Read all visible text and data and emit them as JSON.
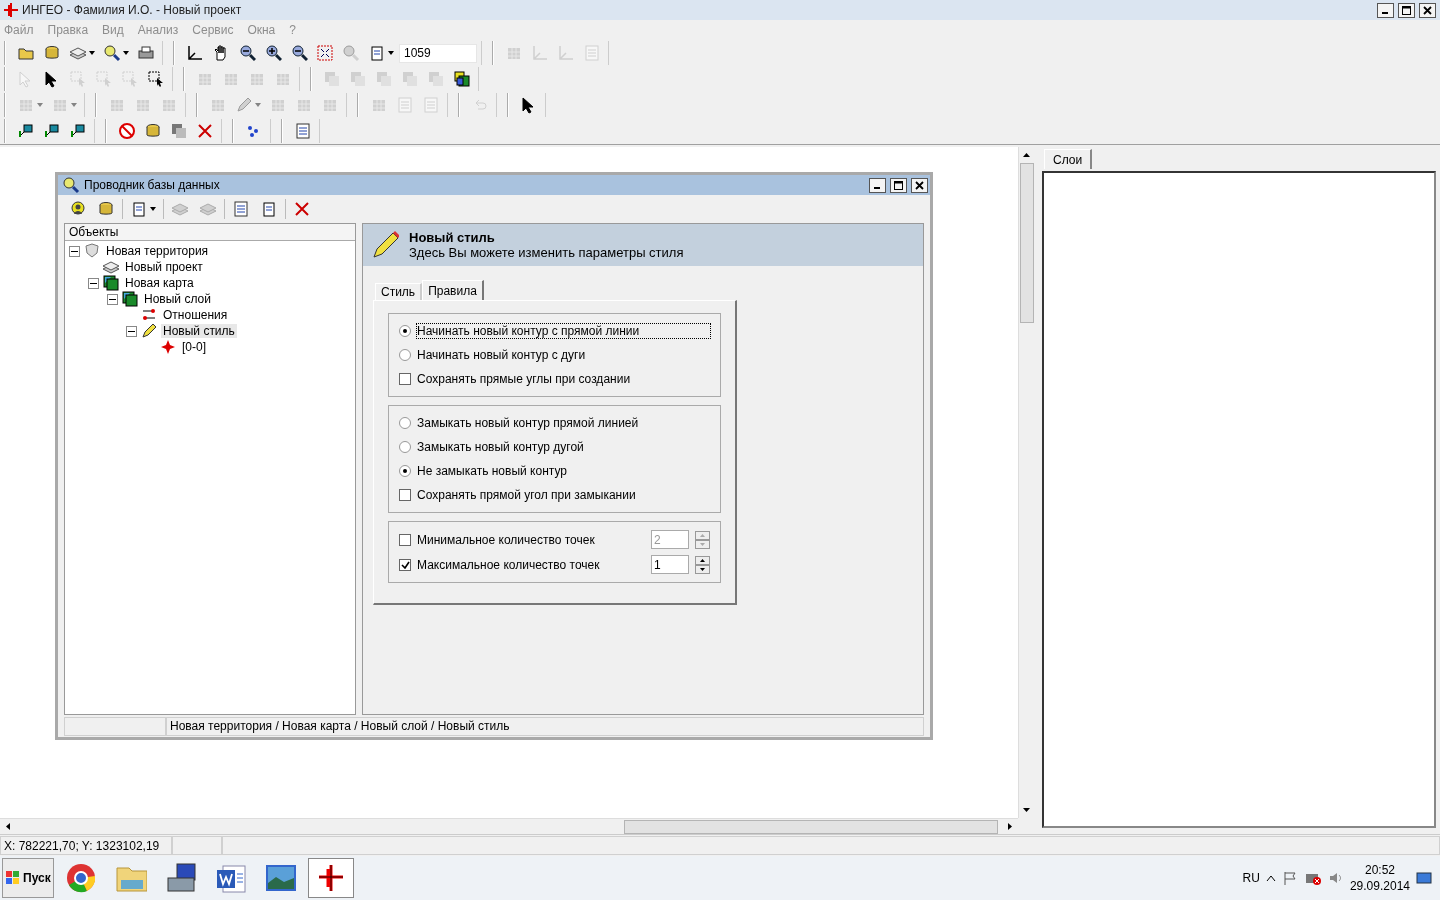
{
  "window": {
    "title": "ИНГЕО - Фамилия И.О. - Новый проект"
  },
  "menu": [
    {
      "label": "Файл",
      "disabled": true
    },
    {
      "label": "Правка",
      "disabled": true
    },
    {
      "label": "Вид",
      "disabled": true
    },
    {
      "label": "Анализ",
      "disabled": true
    },
    {
      "label": "Сервис",
      "disabled": true
    },
    {
      "label": "Окна",
      "disabled": true
    },
    {
      "label": "?",
      "disabled": true
    }
  ],
  "toolbars": [
    [
      [
        {
          "kind": "folder",
          "disabled": false
        },
        {
          "kind": "database",
          "disabled": false
        },
        {
          "kind": "layers",
          "disabled": false,
          "dropdown": true
        },
        {
          "kind": "magnifier",
          "disabled": false,
          "dropdown": true
        },
        {
          "kind": "printer",
          "disabled": false
        }
      ],
      [
        {
          "kind": "axes",
          "disabled": false
        },
        {
          "kind": "hand",
          "disabled": false
        },
        {
          "kind": "zoom-area",
          "disabled": false
        },
        {
          "kind": "zoom-in",
          "disabled": false
        },
        {
          "kind": "zoom-out",
          "disabled": false
        },
        {
          "kind": "extent",
          "disabled": false
        },
        {
          "kind": "magnifier",
          "disabled": true
        },
        {
          "kind": "document",
          "disabled": false,
          "dropdown": true
        },
        {
          "kind": "field",
          "value": "1059"
        }
      ],
      [
        {
          "kind": "grid",
          "disabled": true
        },
        {
          "kind": "axes",
          "disabled": true
        },
        {
          "kind": "axes",
          "disabled": true
        },
        {
          "kind": "table",
          "disabled": true
        }
      ]
    ],
    [
      [
        {
          "kind": "pointer",
          "disabled": true
        },
        {
          "kind": "pointer",
          "disabled": false
        },
        {
          "kind": "selection",
          "disabled": true
        },
        {
          "kind": "selection",
          "disabled": true
        },
        {
          "kind": "selection",
          "disabled": true
        },
        {
          "kind": "selection",
          "disabled": false
        }
      ],
      [
        {
          "kind": "grid",
          "disabled": true
        },
        {
          "kind": "grid",
          "disabled": true
        },
        {
          "kind": "grid",
          "disabled": true
        },
        {
          "kind": "grid",
          "disabled": true
        }
      ],
      [
        {
          "kind": "square",
          "disabled": true
        },
        {
          "kind": "square",
          "disabled": true
        },
        {
          "kind": "square",
          "disabled": true
        },
        {
          "kind": "square",
          "disabled": true
        },
        {
          "kind": "square",
          "disabled": true
        },
        {
          "kind": "stack",
          "disabled": false
        }
      ]
    ],
    [
      [
        {
          "kind": "grid",
          "disabled": true,
          "dropdown": true
        },
        {
          "kind": "grid",
          "disabled": true,
          "dropdown": true
        }
      ],
      [
        {
          "kind": "grid",
          "disabled": true
        },
        {
          "kind": "grid",
          "disabled": true
        },
        {
          "kind": "grid",
          "disabled": true
        }
      ],
      [
        {
          "kind": "grid",
          "disabled": true
        },
        {
          "kind": "pencil",
          "disabled": true,
          "dropdown": true
        },
        {
          "kind": "grid",
          "disabled": true
        },
        {
          "kind": "grid",
          "disabled": true
        },
        {
          "kind": "grid",
          "disabled": true
        }
      ],
      [
        {
          "kind": "grid",
          "disabled": true
        },
        {
          "kind": "table",
          "disabled": true
        },
        {
          "kind": "table",
          "disabled": true
        }
      ],
      [
        {
          "kind": "undo",
          "disabled": true
        }
      ],
      [
        {
          "kind": "pointer",
          "disabled": false
        }
      ]
    ],
    [
      [
        {
          "kind": "pin",
          "disabled": false
        },
        {
          "kind": "pin",
          "disabled": false
        },
        {
          "kind": "pin",
          "disabled": false
        }
      ],
      [
        {
          "kind": "no-sign",
          "disabled": false
        },
        {
          "kind": "database",
          "disabled": false
        },
        {
          "kind": "square",
          "disabled": false
        },
        {
          "kind": "cross",
          "disabled": false
        }
      ],
      [
        {
          "kind": "dots",
          "disabled": false
        }
      ],
      [
        {
          "kind": "table",
          "disabled": false
        }
      ]
    ]
  ],
  "dialog": {
    "title": "Проводник базы данных",
    "toolbar": [
      [
        {
          "kind": "person",
          "disabled": false
        },
        {
          "kind": "database",
          "disabled": false
        }
      ],
      [
        {
          "kind": "document",
          "disabled": false,
          "dropdown": true
        }
      ],
      [
        {
          "kind": "layers",
          "disabled": true
        },
        {
          "kind": "layers",
          "disabled": true
        }
      ],
      [
        {
          "kind": "table",
          "disabled": false
        },
        {
          "kind": "document",
          "disabled": false
        }
      ],
      [
        {
          "kind": "cross",
          "disabled": false
        }
      ]
    ],
    "tree": {
      "header": "Объекты",
      "items": [
        {
          "label": "Новая территория",
          "kind": "shield",
          "selected": false,
          "expanded": true,
          "children": [
            {
              "label": "Новый проект",
              "kind": "layers",
              "selected": false
            },
            {
              "label": "Новая карта",
              "kind": "map",
              "selected": false,
              "expanded": true,
              "children": [
                {
                  "label": "Новый слой",
                  "kind": "map",
                  "selected": false,
                  "expanded": true,
                  "children": [
                    {
                      "label": "Отношения",
                      "kind": "relations",
                      "selected": false
                    },
                    {
                      "label": "Новый стиль",
                      "kind": "pencil",
                      "selected": true,
                      "expanded": true,
                      "children": [
                        {
                          "label": "[0-0]",
                          "kind": "point",
                          "selected": false
                        }
                      ]
                    }
                  ]
                }
              ]
            }
          ]
        }
      ]
    },
    "header": {
      "title": "Новый стиль",
      "subtitle": "Здесь Вы можете изменить параметры стиля"
    },
    "tabs": [
      {
        "label": "Стиль",
        "selected": false
      },
      {
        "label": "Правила",
        "selected": true
      }
    ],
    "groups": [
      [
        {
          "kind": "radio",
          "label": "Начинать новый контур с прямой линии",
          "checked": true,
          "focused": true
        },
        {
          "kind": "radio",
          "label": "Начинать новый контур с дуги",
          "checked": false,
          "focused": false
        },
        {
          "kind": "checkbox",
          "label": "Сохранять прямые углы при создании",
          "checked": false,
          "focused": false
        }
      ],
      [
        {
          "kind": "radio",
          "label": "Замыкать новый контур прямой линией",
          "checked": false,
          "focused": false
        },
        {
          "kind": "radio",
          "label": "Замыкать новый контур дугой",
          "checked": false,
          "focused": false
        },
        {
          "kind": "radio",
          "label": "Не замыкать новый контур",
          "checked": true,
          "focused": false
        },
        {
          "kind": "checkbox",
          "label": "Сохранять прямой угол при замыкании",
          "checked": false,
          "focused": false
        }
      ],
      [
        {
          "kind": "spin",
          "label": "Минимальное количество точек",
          "checked": false,
          "value": "2",
          "focused": false
        },
        {
          "kind": "spin",
          "label": "Максимальное количество точек",
          "checked": true,
          "value": "1",
          "focused": false
        }
      ]
    ],
    "status": "Новая территория / Новая карта / Новый слой / Новый стиль"
  },
  "side_panel": {
    "tabs": [
      {
        "label": "Слои",
        "selected": true
      }
    ]
  },
  "status_bar": "X: 782221,70; Y: 1323102,19",
  "taskbar": {
    "start": "Пуск",
    "apps": [
      {
        "kind": "browser",
        "selected": false
      },
      {
        "kind": "folder",
        "selected": false
      },
      {
        "kind": "toolbox",
        "selected": false
      },
      {
        "kind": "word",
        "selected": false
      },
      {
        "kind": "photo",
        "selected": false
      },
      {
        "kind": "ingeo",
        "selected": true
      }
    ],
    "language": "RU",
    "time": "20:52",
    "date": "29.09.2014"
  }
}
